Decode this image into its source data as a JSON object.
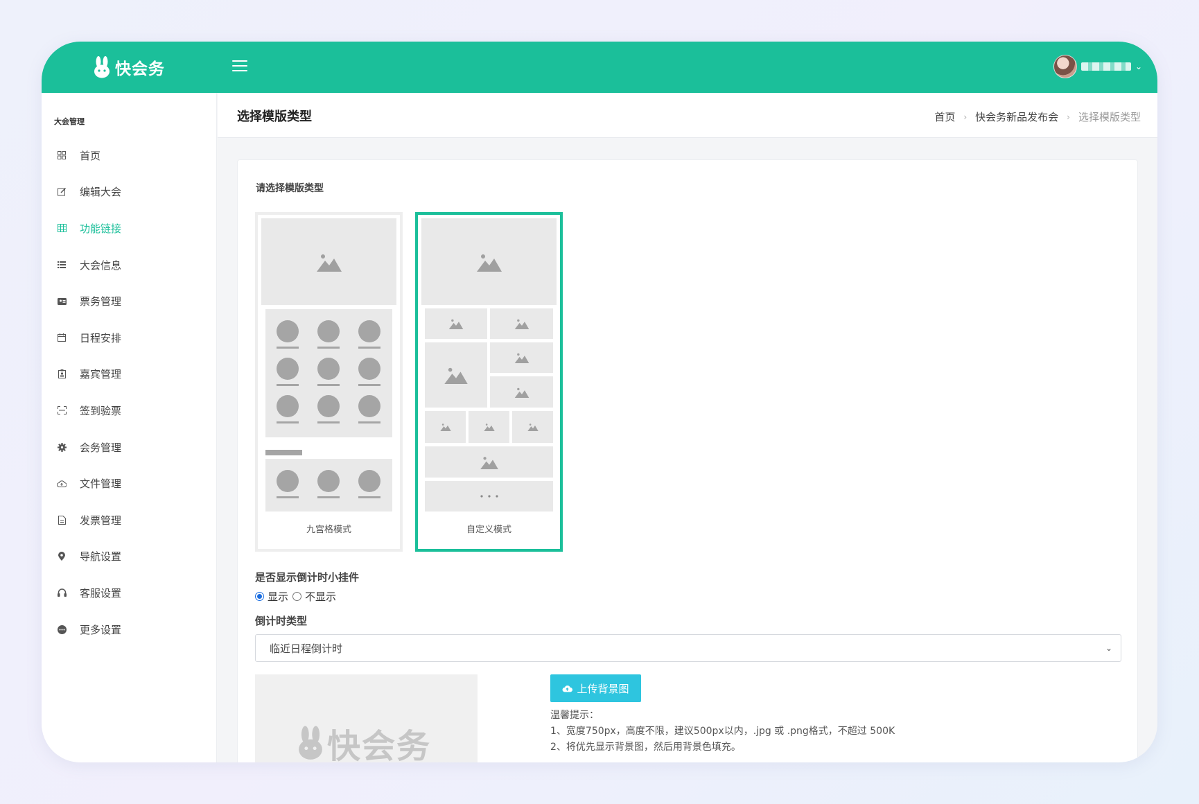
{
  "header": {
    "brand": "快会务",
    "username": ""
  },
  "sidebar": {
    "section": "大会管理",
    "items": [
      {
        "label": "首页",
        "icon": "dashboard-icon"
      },
      {
        "label": "编辑大会",
        "icon": "edit-icon"
      },
      {
        "label": "功能链接",
        "icon": "grid-icon",
        "active": true
      },
      {
        "label": "大会信息",
        "icon": "list-icon"
      },
      {
        "label": "票务管理",
        "icon": "ticket-icon"
      },
      {
        "label": "日程安排",
        "icon": "calendar-icon"
      },
      {
        "label": "嘉宾管理",
        "icon": "guest-icon"
      },
      {
        "label": "签到验票",
        "icon": "scan-icon"
      },
      {
        "label": "会务管理",
        "icon": "gear-icon"
      },
      {
        "label": "文件管理",
        "icon": "cloud-icon"
      },
      {
        "label": "发票管理",
        "icon": "invoice-icon"
      },
      {
        "label": "导航设置",
        "icon": "location-pin-icon"
      },
      {
        "label": "客服设置",
        "icon": "headset-icon"
      },
      {
        "label": "更多设置",
        "icon": "more-icon"
      }
    ]
  },
  "page": {
    "title": "选择模版类型",
    "breadcrumb": [
      "首页",
      "快会务新品发布会",
      "选择模版类型"
    ]
  },
  "content": {
    "choose_label": "请选择模版类型",
    "templates": [
      {
        "caption": "九宫格模式",
        "selected": false
      },
      {
        "caption": "自定义模式",
        "selected": true
      }
    ],
    "countdown_widget_label": "是否显示倒计时小挂件",
    "radio_show": "显示",
    "radio_hide": "不显示",
    "countdown_type_label": "倒计时类型",
    "countdown_type_value": "临近日程倒计时",
    "watermark": "快会务",
    "upload_button": "上传背景图",
    "tips_title": "温馨提示：",
    "tip_1": "1、宽度750px，高度不限，建议500px以内，.jpg 或 .png格式，不超过 500K",
    "tip_2": "2、将优先显示背景图，然后用背景色填充。"
  },
  "colors": {
    "brand": "#1bbf9a",
    "upload": "#2ec5df"
  }
}
